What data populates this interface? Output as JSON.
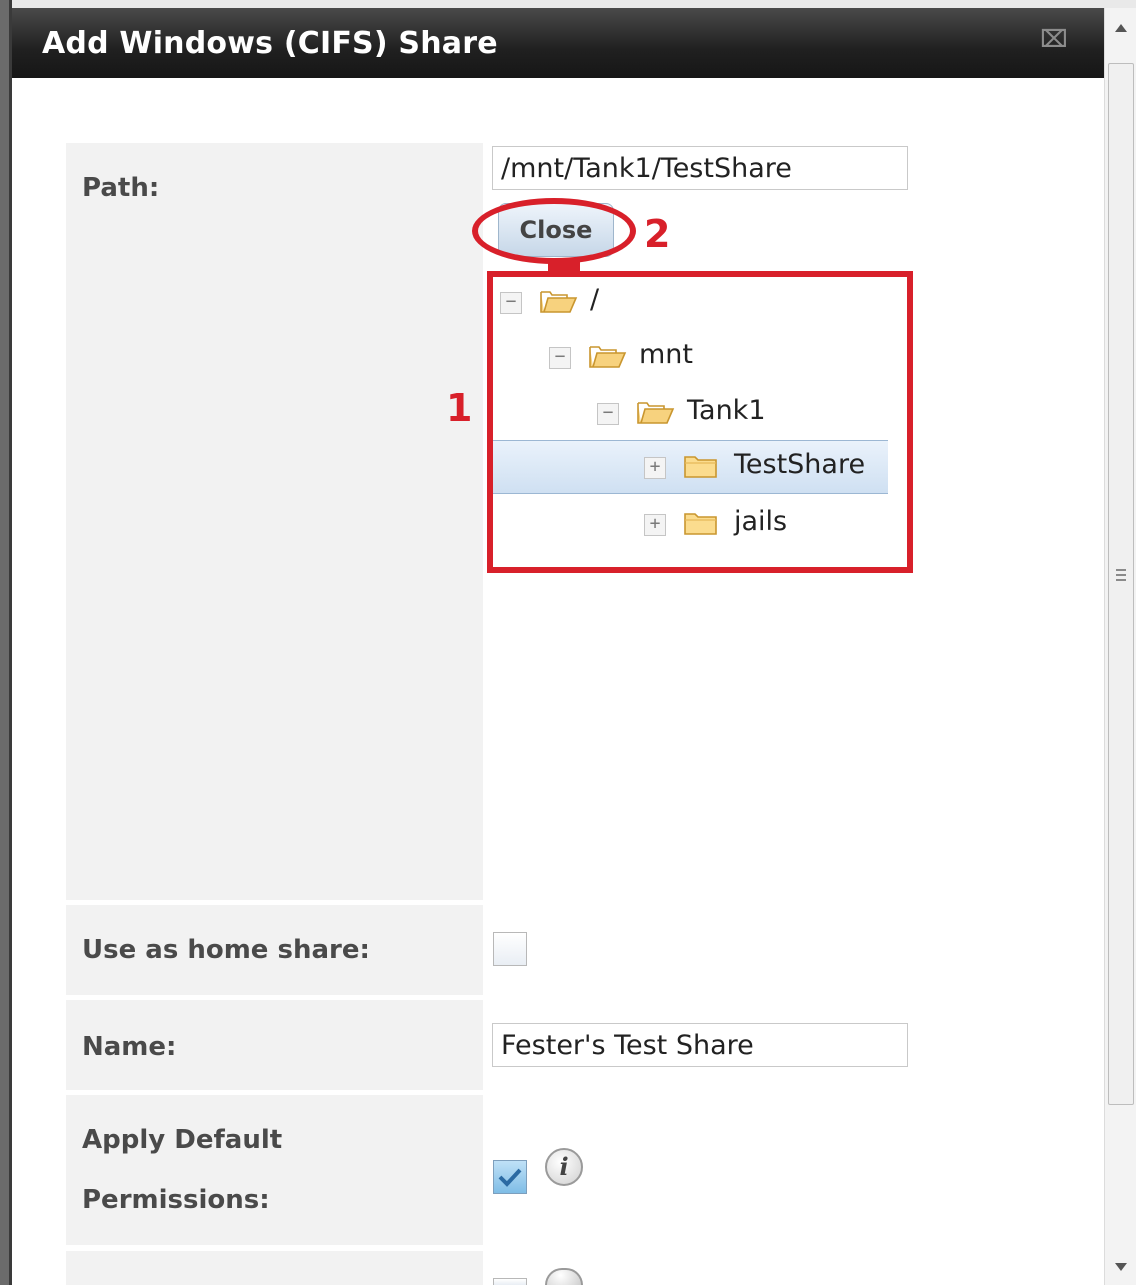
{
  "dialog": {
    "title": "Add Windows (CIFS) Share",
    "close_glyph": "⌧"
  },
  "form": {
    "path_label": "Path:",
    "path_value": "/mnt/Tank1/TestShare",
    "close_button": "Close",
    "home_share_label": "Use as home share:",
    "home_share_checked": false,
    "name_label": "Name:",
    "name_value": "Fester's Test Share",
    "apply_perm_label_1": "Apply Default",
    "apply_perm_label_2": "Permissions:",
    "apply_perm_checked": true
  },
  "tree": {
    "nodes": [
      {
        "label": "/",
        "toggle": "−",
        "folder": "open",
        "selected": false
      },
      {
        "label": "mnt",
        "toggle": "−",
        "folder": "open",
        "selected": false
      },
      {
        "label": "Tank1",
        "toggle": "−",
        "folder": "open",
        "selected": false
      },
      {
        "label": "TestShare",
        "toggle": "+",
        "folder": "closed",
        "selected": true
      },
      {
        "label": "jails",
        "toggle": "+",
        "folder": "closed",
        "selected": false
      }
    ]
  },
  "annotations": {
    "marker_1": "1",
    "marker_2": "2",
    "color": "#d8202a"
  },
  "icons": {
    "info": "i"
  }
}
